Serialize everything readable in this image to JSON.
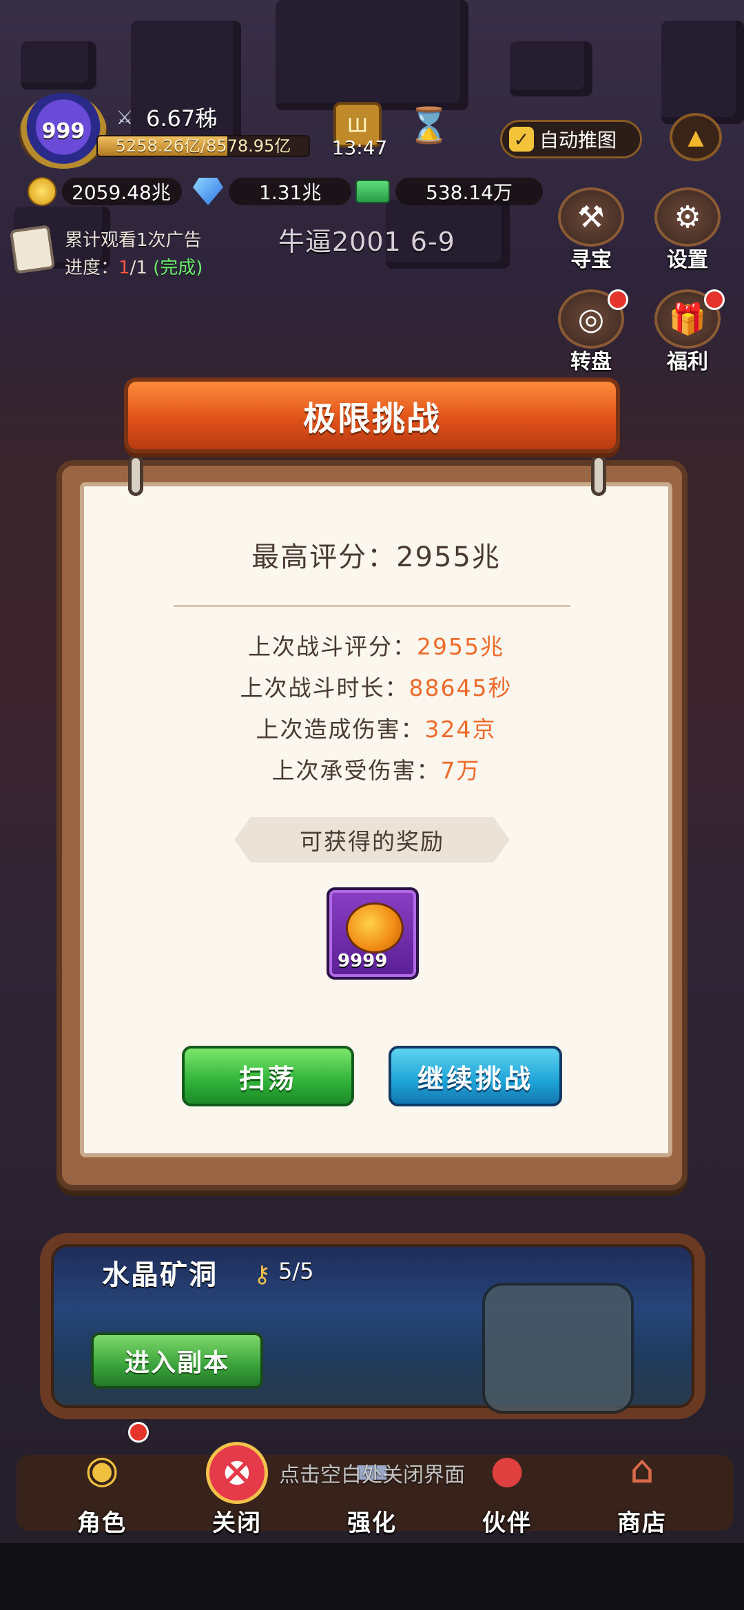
{
  "hud": {
    "level": "999",
    "power": "6.67秭",
    "exp_text": "5258.26亿/8578.95亿",
    "exp_fraction": 0.613,
    "timer": "13:47",
    "auto_label": "自动推图",
    "resources": {
      "gold": "2059.48兆",
      "gems": "1.31兆",
      "cash": "538.14万"
    }
  },
  "task": {
    "line1": "累计观看1次广告",
    "progress_label": "进度：",
    "progress_current": "1",
    "progress_total": "/1",
    "status": "(完成)"
  },
  "stage_name": "牛逼2001 6-9",
  "side_buttons": {
    "treasure": "寻宝",
    "settings": "设置",
    "wheel": "转盘",
    "welfare": "福利"
  },
  "dialog": {
    "title": "极限挑战",
    "best_score_label": "最高评分：",
    "best_score_value": "2955兆",
    "stats": [
      {
        "label": "上次战斗评分：",
        "value": "2955兆"
      },
      {
        "label": "上次战斗时长：",
        "value": "88645秒"
      },
      {
        "label": "上次造成伤害：",
        "value": "324京"
      },
      {
        "label": "上次承受伤害：",
        "value": "7万"
      }
    ],
    "reward_banner": "可获得的奖励",
    "reward_count": "9999",
    "sweep_button": "扫荡",
    "continue_button": "继续挑战"
  },
  "dungeon": {
    "title": "水晶矿洞",
    "keys": "5/5",
    "enter_button": "进入副本"
  },
  "hint": "点击空白处关闭界面",
  "nav": {
    "role": "角色",
    "close": "关闭",
    "enhance": "强化",
    "partner": "伙伴",
    "shop": "商店"
  },
  "colors": {
    "accent_orange": "#ee6a2a",
    "success_green": "#6cf06c",
    "alert_red": "#ff5a4a"
  }
}
